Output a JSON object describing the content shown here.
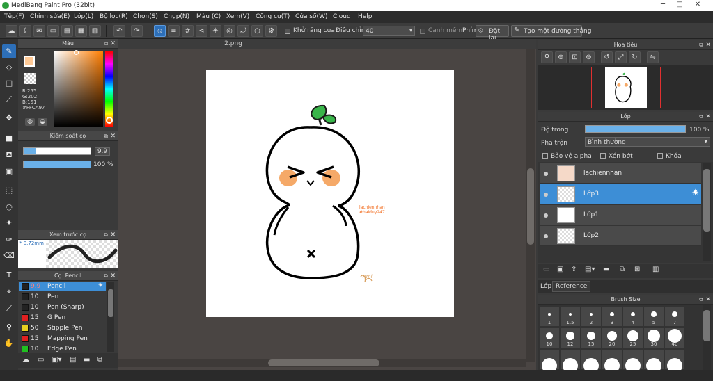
{
  "window": {
    "title": "MediBang Paint Pro (32bit)",
    "minimize": "─",
    "maximize": "□",
    "close": "✕"
  },
  "menu": [
    "Tệp(F)",
    "Chỉnh sửa(E)",
    "Lớp(L)",
    "Bộ lọc(R)",
    "Chọn(S)",
    "Chụp(N)",
    "Màu (C)",
    "Xem(V)",
    "Công cụ(T)",
    "Cửa sổ(W)",
    "Cloud",
    "Help"
  ],
  "toolbar": {
    "antialias_label": "Khử răng cưa",
    "correction_label": "Điều chỉnh",
    "correction_value": "40",
    "edge_label": "Cạnh mềm",
    "reset_label": "Đặt lại",
    "straight_label": "Tạo một đường thẳng",
    "phim_label": "Phím"
  },
  "color_panel": {
    "title": "Màu",
    "r": "R:255",
    "g": "G:202",
    "b": "B:151",
    "hex": "#FFCA97",
    "fg_color": "#FFCA97"
  },
  "brush_control": {
    "title": "Kiểm soát cọ",
    "size": "9.9",
    "opacity": "100 %"
  },
  "preview": {
    "title": "Xem trước cọ",
    "size": "* 0.72mm"
  },
  "brush_list": {
    "title": "Cọ: Pencil",
    "items": [
      {
        "value": "9.9",
        "name": "Pencil",
        "color": "#222222",
        "selected": true
      },
      {
        "value": "10",
        "name": "Pen",
        "color": "#222222"
      },
      {
        "value": "10",
        "name": "Pen (Sharp)",
        "color": "#222222"
      },
      {
        "value": "15",
        "name": "G Pen",
        "color": "#e02020"
      },
      {
        "value": "50",
        "name": "Stipple Pen",
        "color": "#e8d020"
      },
      {
        "value": "15",
        "name": "Mapping Pen",
        "color": "#e02020"
      },
      {
        "value": "10",
        "name": "Edge Pen",
        "color": "#20c020"
      }
    ]
  },
  "document": {
    "tab": "2.png",
    "watermark_line1": "lachiennhan",
    "watermark_line2": "#haiduy247",
    "signature": "Ami"
  },
  "navigator": {
    "title": "Hoa tiêu"
  },
  "layers": {
    "title": "Lớp",
    "opacity_label": "Độ trong",
    "opacity_value": "100 %",
    "blend_label": "Pha trộn",
    "blend_value": "Bình thường",
    "protect_alpha": "Bảo vệ alpha",
    "clipping": "Xén bớt",
    "lock": "Khóa",
    "items": [
      {
        "name": "lachiennhan"
      },
      {
        "name": "Lớp3",
        "selected": true
      },
      {
        "name": "Lớp1"
      },
      {
        "name": "Lớp2"
      }
    ]
  },
  "tabs": {
    "layer": "Lớp",
    "reference": "Reference"
  },
  "brush_size": {
    "title": "Brush Size",
    "sizes": [
      "1",
      "1.5",
      "2",
      "3",
      "4",
      "5",
      "7",
      "10",
      "12",
      "15",
      "20",
      "25",
      "30",
      "40"
    ]
  }
}
